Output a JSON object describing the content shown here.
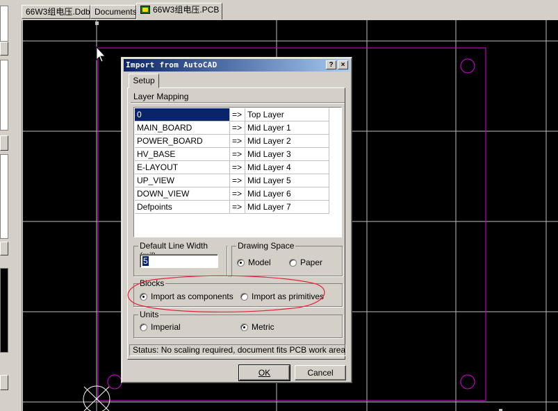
{
  "tabs": [
    {
      "label": "66W3组电压.Ddb",
      "active": false
    },
    {
      "label": "Documents",
      "active": false
    },
    {
      "label": "66W3组电压.PCB",
      "active": true
    }
  ],
  "dialog": {
    "title": "Import from AutoCAD",
    "help_label": "?",
    "close_label": "×",
    "tab_label": "Setup",
    "layer_mapping": {
      "title": "Layer Mapping",
      "rows": [
        {
          "source": "0",
          "arrow": "=>",
          "target": "Top Layer"
        },
        {
          "source": "MAIN_BOARD",
          "arrow": "=>",
          "target": "Mid Layer 1"
        },
        {
          "source": "POWER_BOARD",
          "arrow": "=>",
          "target": "Mid Layer 2"
        },
        {
          "source": "HV_BASE",
          "arrow": "=>",
          "target": "Mid Layer 3"
        },
        {
          "source": "E-LAYOUT",
          "arrow": "=>",
          "target": "Mid Layer 4"
        },
        {
          "source": "UP_VIEW",
          "arrow": "=>",
          "target": "Mid Layer 5"
        },
        {
          "source": "DOWN_VIEW",
          "arrow": "=>",
          "target": "Mid Layer 6"
        },
        {
          "source": "Defpoints",
          "arrow": "=>",
          "target": "Mid Layer 7"
        }
      ]
    },
    "line_width": {
      "label": "Default Line Width (mil)",
      "value": "5"
    },
    "drawing_space": {
      "label": "Drawing Space",
      "model": "Model",
      "paper": "Paper",
      "selected": "Model"
    },
    "blocks": {
      "label": "Blocks",
      "components": "Import as components",
      "primitives": "Import as primitives",
      "selected": "Import as components"
    },
    "units": {
      "label": "Units",
      "imperial": "Imperial",
      "metric": "Metric",
      "selected": "Metric"
    },
    "status": "Status:  No scaling required, document fits PCB work area",
    "ok_label": "OK",
    "cancel_label": "Cancel"
  },
  "colors": {
    "canvas": "#000000",
    "grid": "#ffffff",
    "board_outline": "#c000c0",
    "annotation": "#e8203a",
    "title_active": "#0a246a",
    "selection": "#0a246a"
  }
}
